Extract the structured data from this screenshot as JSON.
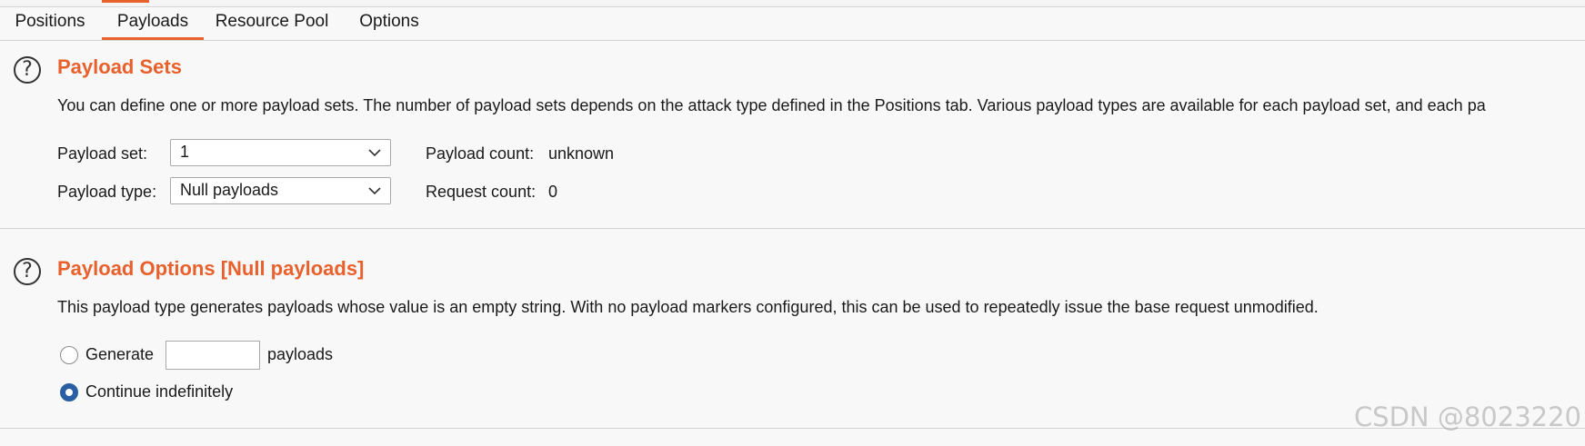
{
  "tabs": [
    {
      "label": "Positions",
      "active": false
    },
    {
      "label": "Payloads",
      "active": true
    },
    {
      "label": "Resource Pool",
      "active": false
    },
    {
      "label": "Options",
      "active": false
    }
  ],
  "payload_sets": {
    "title": "Payload Sets",
    "description": "You can define one or more payload sets. The number of payload sets depends on the attack type defined in the Positions tab. Various payload types are available for each payload set, and each pa",
    "set_label": "Payload set:",
    "set_value": "1",
    "type_label": "Payload type:",
    "type_value": "Null payloads",
    "count_label": "Payload count:",
    "count_value": "unknown",
    "request_label": "Request count:",
    "request_value": "0"
  },
  "payload_options": {
    "title": "Payload Options [Null payloads]",
    "description": "This payload type generates payloads whose value is an empty string. With no payload markers configured, this can be used to repeatedly issue the base request unmodified.",
    "generate_label": "Generate",
    "generate_value": "",
    "payloads_suffix": "payloads",
    "continue_label": "Continue indefinitely",
    "selected": "continue"
  },
  "icons": {
    "help": "help-icon",
    "chevron": "chevron-down-icon"
  },
  "help_glyph": "?",
  "colors": {
    "accent": "#e8602c",
    "radio_selected": "#2b5fa3"
  },
  "watermark": "CSDN @8023220"
}
